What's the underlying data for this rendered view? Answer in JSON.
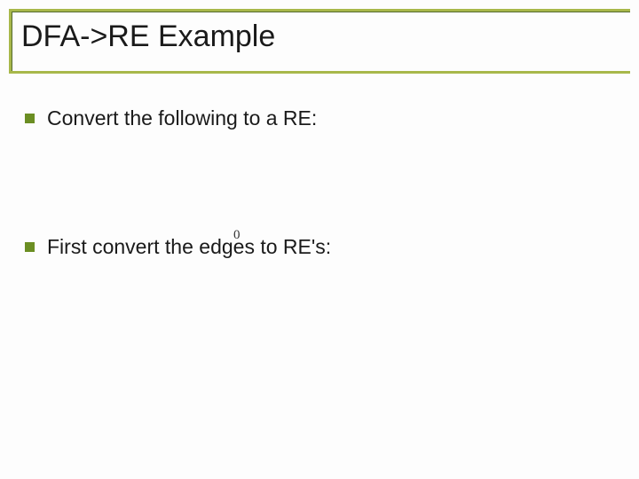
{
  "title": "DFA->RE Example",
  "bullets": [
    {
      "text": "Convert the following to a RE:"
    },
    {
      "text": "First convert the edges to RE's:"
    }
  ],
  "diagram": {
    "label_zero": "0"
  }
}
